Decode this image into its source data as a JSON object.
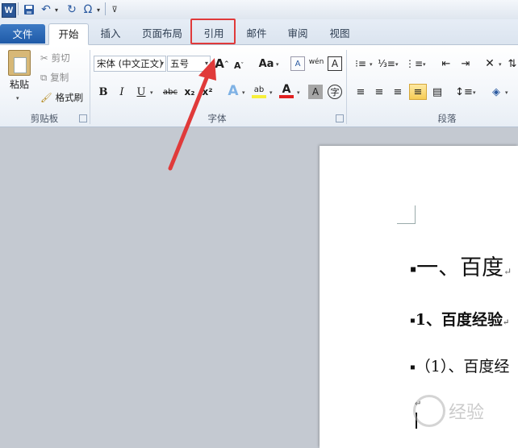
{
  "qat": {
    "logo": "W",
    "save_icon": "floppy-icon",
    "undo_icon": "undo-icon",
    "redo_icon": "redo-icon",
    "symbol_glyph": "Ω"
  },
  "tabs": [
    "文件",
    "开始",
    "插入",
    "页面布局",
    "引用",
    "邮件",
    "审阅",
    "视图"
  ],
  "active_tab": "开始",
  "highlighted_tab": "引用",
  "clipboard": {
    "paste": "粘贴",
    "cut": "剪切",
    "copy": "复制",
    "format_painter": "格式刷",
    "label": "剪贴板"
  },
  "font": {
    "family": "宋体 (中文正文)",
    "size": "五号",
    "label": "字体",
    "grow": "A",
    "shrink": "A",
    "change_case": "Aa",
    "bold": "B",
    "italic": "I",
    "underline": "U",
    "strikethrough": "abc",
    "subscript": "x₂",
    "superscript": "x²",
    "phonetic": "wén",
    "border_char": "A",
    "text_effect": "A",
    "highlight": "ab",
    "font_color": "A",
    "char_shading": "A",
    "enclose": "字"
  },
  "paragraph": {
    "label": "段落"
  },
  "document": {
    "heading1": "一、百度",
    "heading2": "1、百度经验",
    "heading3": "（1）、百度经",
    "para_mark": "↵"
  },
  "watermark": {
    "text": "经验"
  },
  "colors": {
    "accent": "#2b5797",
    "highlight_box": "#e03a3a",
    "arrow": "#e03a3a"
  }
}
